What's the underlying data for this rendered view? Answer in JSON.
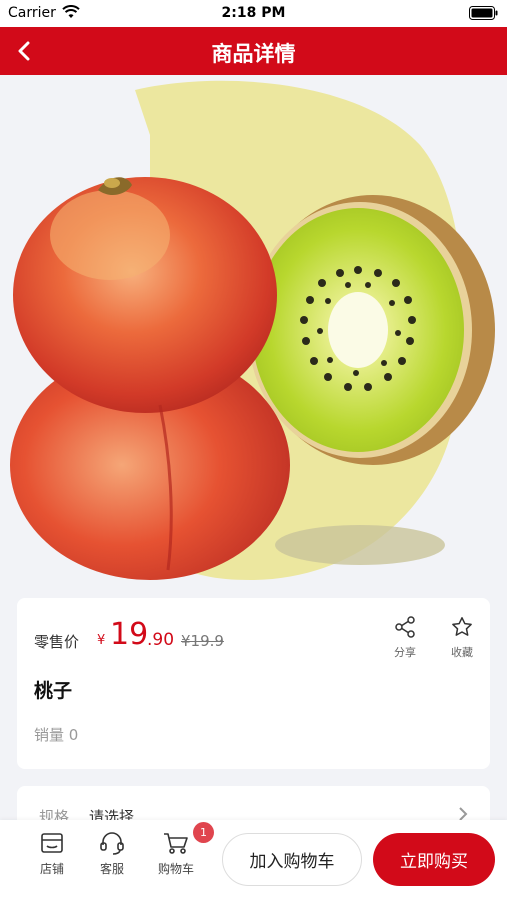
{
  "status_bar": {
    "carrier": "Carrier",
    "time": "2:18 PM"
  },
  "nav": {
    "title": "商品详情",
    "back_icon": "chevron-left-icon"
  },
  "product": {
    "image_alt": "peach-and-kiwi-photo",
    "price_label": "零售价",
    "currency_symbol": "¥",
    "price_integer": "19",
    "price_decimal": ".90",
    "original_price": "¥19.9",
    "name": "桃子",
    "sales_label": "销量",
    "sales_count": "0"
  },
  "actions": {
    "share_label": "分享",
    "favorite_label": "收藏"
  },
  "spec": {
    "label": "规格",
    "value": "请选择"
  },
  "tab_bar": {
    "store_label": "店铺",
    "service_label": "客服",
    "cart_label": "购物车",
    "cart_badge": "1",
    "add_to_cart": "加入购物车",
    "buy_now": "立即购买"
  },
  "colors": {
    "brand_red": "#d20a19",
    "background": "#f2f3f7",
    "badge": "#e0454e"
  }
}
